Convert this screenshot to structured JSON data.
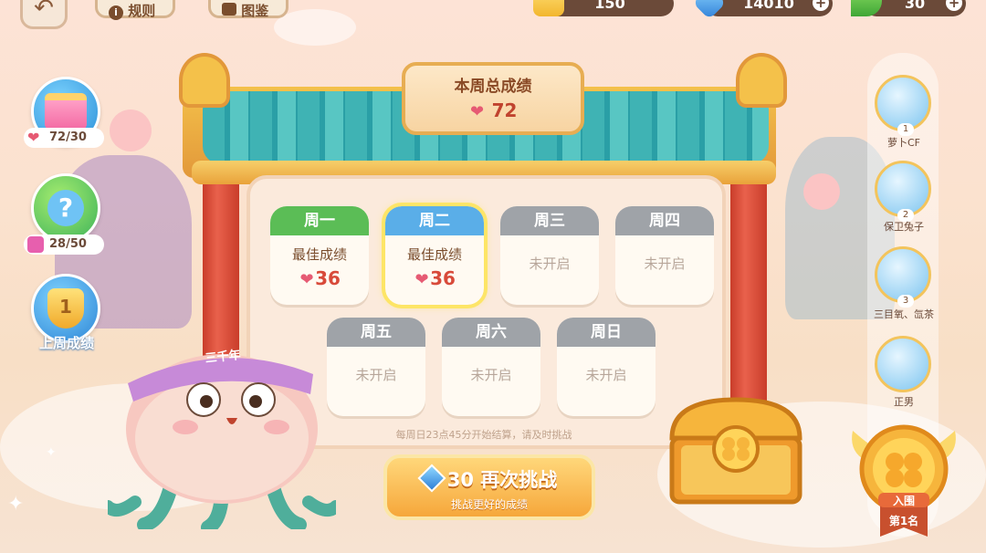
{
  "top_bar": {
    "rules_label": "规则",
    "gallery_label": "图鉴",
    "gold": "150",
    "gems": "14010",
    "energy": "30"
  },
  "left": {
    "gift_progress": "72/30",
    "quiz_progress": "28/50",
    "last_week_label": "上周成绩",
    "trophy_number": "1"
  },
  "board": {
    "title": "本周总成绩",
    "total_hearts": "72",
    "days": [
      {
        "name": "周一",
        "label": "最佳成绩",
        "score": "36",
        "state": "done",
        "color": "#5bbd56"
      },
      {
        "name": "周二",
        "label": "最佳成绩",
        "score": "36",
        "state": "selected",
        "color": "#5aaee8"
      },
      {
        "name": "周三",
        "label": "未开启",
        "state": "locked",
        "color": "#9fa3a8"
      },
      {
        "name": "周四",
        "label": "未开启",
        "state": "locked",
        "color": "#9fa3a8"
      },
      {
        "name": "周五",
        "label": "未开启",
        "state": "locked",
        "color": "#9fa3a8"
      },
      {
        "name": "周六",
        "label": "未开启",
        "state": "locked",
        "color": "#9fa3a8"
      },
      {
        "name": "周日",
        "label": "未开启",
        "state": "locked",
        "color": "#9fa3a8"
      }
    ],
    "notice": "每周日23点45分开始结算，请及时挑战"
  },
  "retry": {
    "cost": "30",
    "label": "再次挑战",
    "sub": "挑战更好的成绩"
  },
  "character": {
    "headband": "三千年"
  },
  "ranking": {
    "items": [
      {
        "rank": "1",
        "name": "萝卜CF"
      },
      {
        "rank": "2",
        "name": "保卫兔子"
      },
      {
        "rank": "3",
        "name": "三目氧、氙茶"
      },
      {
        "rank": "",
        "name": "正男"
      }
    ],
    "medal_top": "入围",
    "medal_bottom": "第1名"
  },
  "colors": {
    "heart": "#e65a73",
    "score": "#d84a3a",
    "pillar": "#d24a34",
    "tiles": "#3fb3b4",
    "gold": "#f4c14a"
  }
}
